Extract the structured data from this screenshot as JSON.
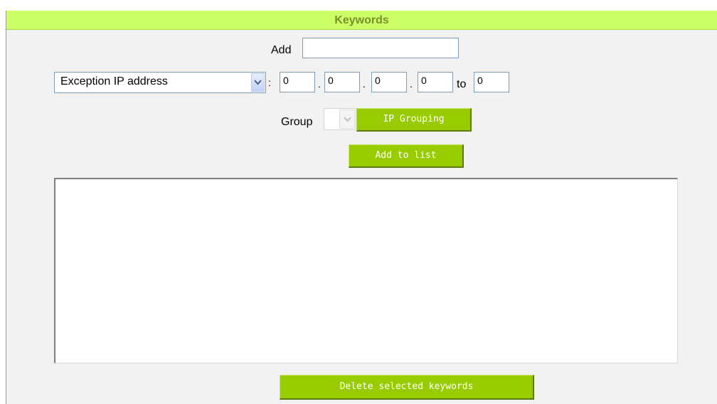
{
  "header": {
    "title": "Keywords"
  },
  "add_field": {
    "label": "Add",
    "value": ""
  },
  "type_select": {
    "selected": "Exception IP address"
  },
  "ip_range": {
    "separator_colon": ":",
    "dot": ".",
    "octet1": "0",
    "octet2": "0",
    "octet3": "0",
    "octet4": "0",
    "to_label": "to",
    "to_value": "0"
  },
  "group": {
    "label": "Group",
    "selected": ""
  },
  "buttons": {
    "ip_grouping": "IP Grouping",
    "add_to_list": "Add to list",
    "delete_selected": "Delete selected keywords"
  },
  "keyword_list": {
    "items": []
  },
  "colors": {
    "header_bg": "#ccff66",
    "header_text": "#7a8f2c",
    "button_bg": "#99cc00",
    "panel_bg": "#f2f2f2"
  },
  "icons": {
    "dropdown": "chevron-down-icon"
  }
}
